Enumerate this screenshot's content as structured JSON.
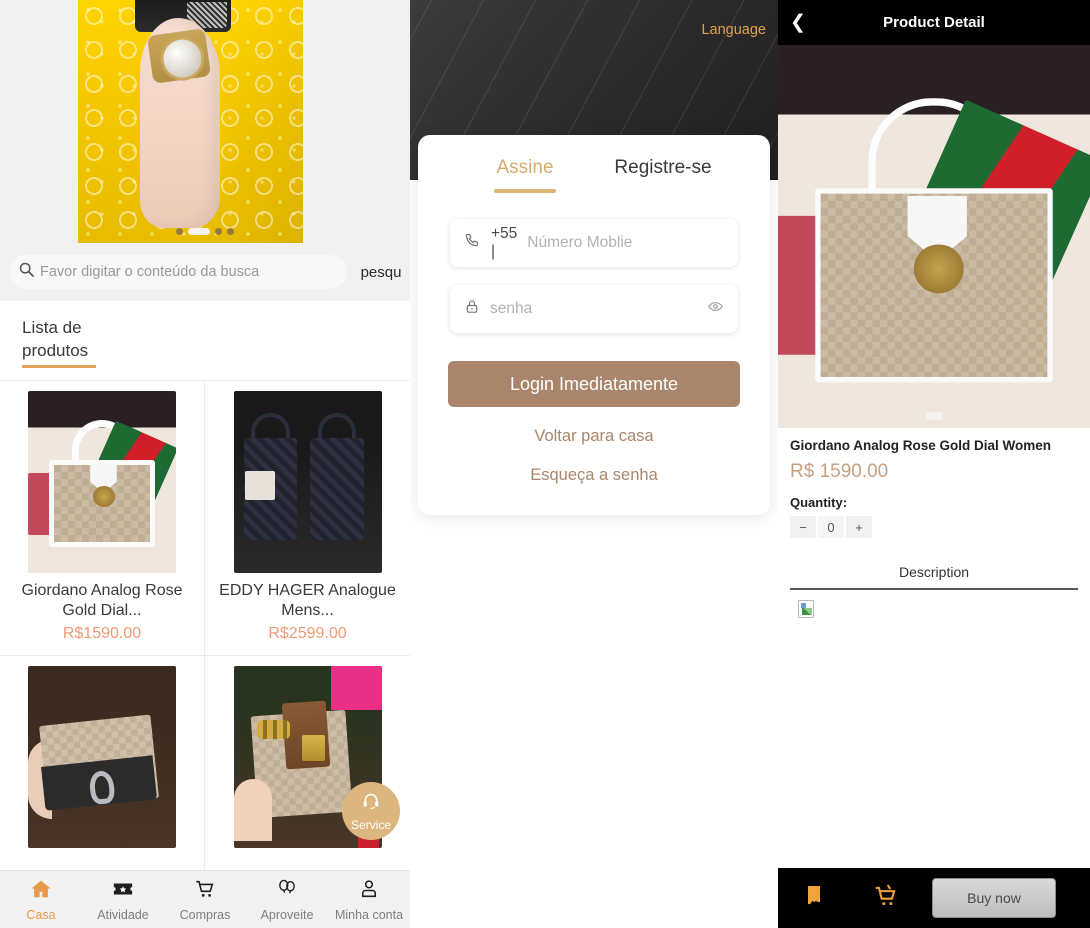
{
  "home": {
    "banner": {
      "name": "promo-banner",
      "dots": 4,
      "active_dot": 1
    },
    "search": {
      "placeholder": "Favor digitar o conteúdo da busca",
      "value": "",
      "button_label": "pesqu",
      "icon": "search-icon"
    },
    "section_title": "Lista de produtos",
    "products": [
      {
        "title": "Giordano Analog Rose Gold Dial...",
        "price": "R$1590.00",
        "art": "bag-a"
      },
      {
        "title": "EDDY HAGER Analogue Mens...",
        "price": "R$2599.00",
        "art": "bag-b"
      },
      {
        "title": "",
        "price": "",
        "art": "bag-c"
      },
      {
        "title": "",
        "price": "",
        "art": "bag-d"
      }
    ],
    "service_fab": {
      "label": "Service",
      "icon": "headset-icon"
    },
    "tabbar": [
      {
        "label": "Casa",
        "icon": "home-icon",
        "active": true
      },
      {
        "label": "Atividade",
        "icon": "ticket-icon",
        "active": false
      },
      {
        "label": "Compras",
        "icon": "cart-icon",
        "active": false
      },
      {
        "label": "Aproveite",
        "icon": "balloons-icon",
        "active": false
      },
      {
        "label": "Minha conta",
        "icon": "user-icon",
        "active": false
      }
    ]
  },
  "login": {
    "language_label": "Language",
    "tabs": [
      {
        "label": "Assine",
        "active": true
      },
      {
        "label": "Registre-se",
        "active": false
      }
    ],
    "phone_field": {
      "country_code": "+55 |",
      "placeholder": "Número Moblie",
      "value": "",
      "icon": "phone-icon"
    },
    "password_field": {
      "placeholder": "senha",
      "value": "",
      "icon": "lock-icon",
      "toggle_icon": "eye-icon"
    },
    "submit_label": "Login Imediatamente",
    "links": [
      "Voltar para casa",
      "Esqueça a senha"
    ]
  },
  "detail": {
    "nav": {
      "back_icon": "chevron-left-icon",
      "title": "Product Detail"
    },
    "product_name": "Giordano Analog Rose Gold Dial Women",
    "price": "R$ 1590.00",
    "quantity_label": "Quantity:",
    "quantity": {
      "minus": "−",
      "value": "0",
      "plus": "+"
    },
    "description_label": "Description",
    "description_image": "broken-image-icon",
    "footer": {
      "shop_icon": "store-icon",
      "cart_icon": "cart-icon",
      "buy_label": "Buy now"
    }
  },
  "colors": {
    "accent_orange": "#e79a49",
    "price_coral": "#ef9a72",
    "login_brown": "#a9866b",
    "tab_gold": "#dcb474",
    "detail_price": "#c4a183",
    "fab_gold": "#dcb67e"
  }
}
